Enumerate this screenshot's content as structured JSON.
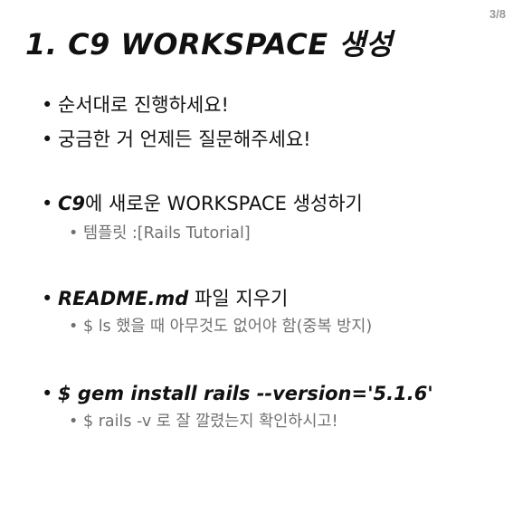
{
  "page_number": "3/8",
  "title": "1. C9 WORKSPACE 생성",
  "bullets": {
    "b1": "순서대로 진행하세요!",
    "b2": "궁금한 거 언제든 질문해주세요!",
    "b3_bold": "C9",
    "b3_rest": "에 새로운 WORKSPACE 생성하기",
    "b3_sub": "템플릿 :[Rails Tutorial]",
    "b4_bold": "README.md",
    "b4_rest": " 파일 지우기",
    "b4_sub": "$ ls 했을 때 아무것도 없어야 함(중복 방지)",
    "b5_bold": "$ gem install rails --version='5.1.6'",
    "b5_sub": "$ rails -v 로 잘 깔렸는지 확인하시고!"
  },
  "bullet_char": "•"
}
